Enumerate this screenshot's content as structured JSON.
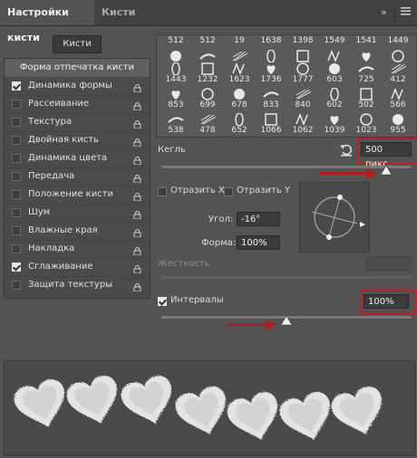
{
  "tabs": [
    {
      "label": "Настройки кисти"
    },
    {
      "label": "Кисти"
    }
  ],
  "header": {
    "collapse_icon": "double-chevron-right-icon",
    "menu_icon": "panel-menu-icon"
  },
  "brushes_button": "Кисти",
  "sidebar": {
    "header": "Форма отпечатка кисти",
    "items": [
      {
        "label": "Динамика формы",
        "checked": true
      },
      {
        "label": "Рассеивание",
        "checked": false
      },
      {
        "label": "Текстура",
        "checked": false
      },
      {
        "label": "Двойная кисть",
        "checked": false
      },
      {
        "label": "Динамика цвета",
        "checked": false
      },
      {
        "label": "Передача",
        "checked": false
      },
      {
        "label": "Положение кисти",
        "checked": false
      },
      {
        "label": "Шум",
        "checked": false
      },
      {
        "label": "Влажные края",
        "checked": false
      },
      {
        "label": "Накладка",
        "checked": false
      },
      {
        "label": "Сглаживание",
        "checked": true
      },
      {
        "label": "Защита текстуры",
        "checked": false
      }
    ]
  },
  "brush_rows": [
    [
      "512",
      "512",
      "19",
      "1638",
      "1398",
      "1549",
      "1541",
      "1449"
    ],
    [
      "1443",
      "1232",
      "1623",
      "1736",
      "1777",
      "603",
      "725",
      "412"
    ],
    [
      "853",
      "699",
      "678",
      "833",
      "840",
      "602",
      "502",
      "566"
    ],
    [
      "538",
      "478",
      "652",
      "1066",
      "1062",
      "1039",
      "1023",
      "955"
    ]
  ],
  "size": {
    "label": "Кегль",
    "value": "500 пикс.",
    "level": 1.0
  },
  "flip_x": "Отразить X",
  "flip_y": "Отразить Y",
  "angle": {
    "label": "Угол:",
    "value": "-16°"
  },
  "roundness": {
    "label": "Форма:",
    "value": "100%"
  },
  "hardness": {
    "label": "Жесткость"
  },
  "spacing": {
    "label": "Интервалы",
    "value": "100%",
    "checked": true,
    "level": 0.5
  },
  "accent_red": "#c31d1d"
}
